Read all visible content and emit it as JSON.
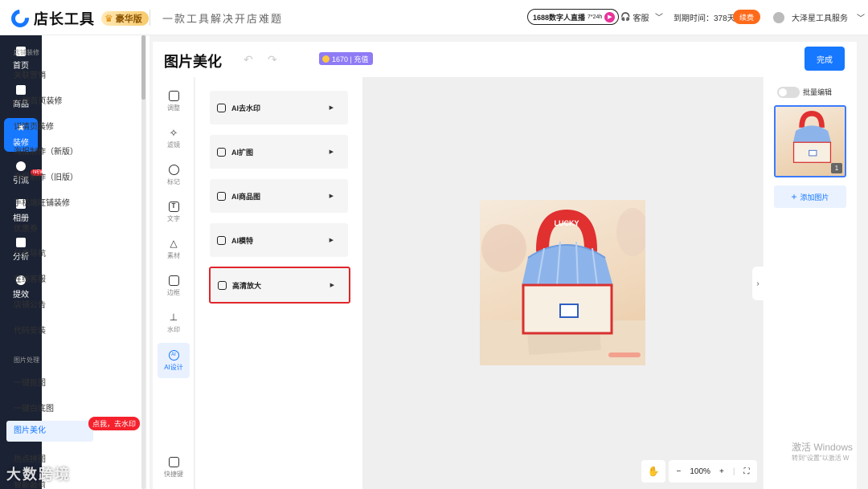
{
  "header": {
    "app_name": "店长工具",
    "edition": "豪华版",
    "slogan": "一款工具解决开店难题",
    "live_label": "1688数字人直播",
    "live_hours": "7*24h",
    "service": "客服",
    "expiry": "到期时间：378天",
    "renew": "续费",
    "user": "大泽星工具服务"
  },
  "leftnav": {
    "items": [
      {
        "label": "首页",
        "icon": "home-icon"
      },
      {
        "label": "商品",
        "icon": "bag-icon"
      },
      {
        "label": "装修",
        "icon": "tools-icon",
        "active": true
      },
      {
        "label": "引流",
        "icon": "person-icon",
        "badge": "NEW"
      },
      {
        "label": "相册",
        "icon": "image-icon"
      },
      {
        "label": "分析",
        "icon": "chart-icon"
      },
      {
        "label": "提效",
        "icon": "clock-icon"
      }
    ]
  },
  "subnav": {
    "section1": "店铺装修",
    "items1": [
      "关联营销",
      "pc端首页装修",
      "详情页装修",
      "海报制作（新版）",
      "海报制作（旧版）",
      "手机端旺铺装修",
      "优惠券",
      "分类导航",
      "在线客服",
      "店铺公告",
      "代码安装"
    ],
    "section2": "图片处理",
    "items2": [
      "一键抠图",
      "一键白底图",
      "图片美化",
      "热点拼图",
      "智能裁剪"
    ],
    "active_tip": "点我，去水印"
  },
  "editor": {
    "title": "图片美化",
    "credit": "1670 | 充值",
    "done": "完成",
    "tools": [
      "调整",
      "滤镜",
      "标记",
      "文字",
      "素材",
      "边框",
      "水印",
      "AI设计",
      "快捷键"
    ],
    "ai_cards": [
      "AI去水印",
      "AI扩图",
      "AI商品图",
      "AI模特",
      "高清放大"
    ],
    "zoom": "100%"
  },
  "right": {
    "batch": "批量编辑",
    "thumb_index": "1",
    "add_image": "添加图片"
  },
  "overlays": {
    "activate_line1": "激活 Windows",
    "activate_line2": "转到\"设置\"以激活 W",
    "wm_bottom_left": "大数跨境",
    "photo_text": "LUCKY"
  }
}
